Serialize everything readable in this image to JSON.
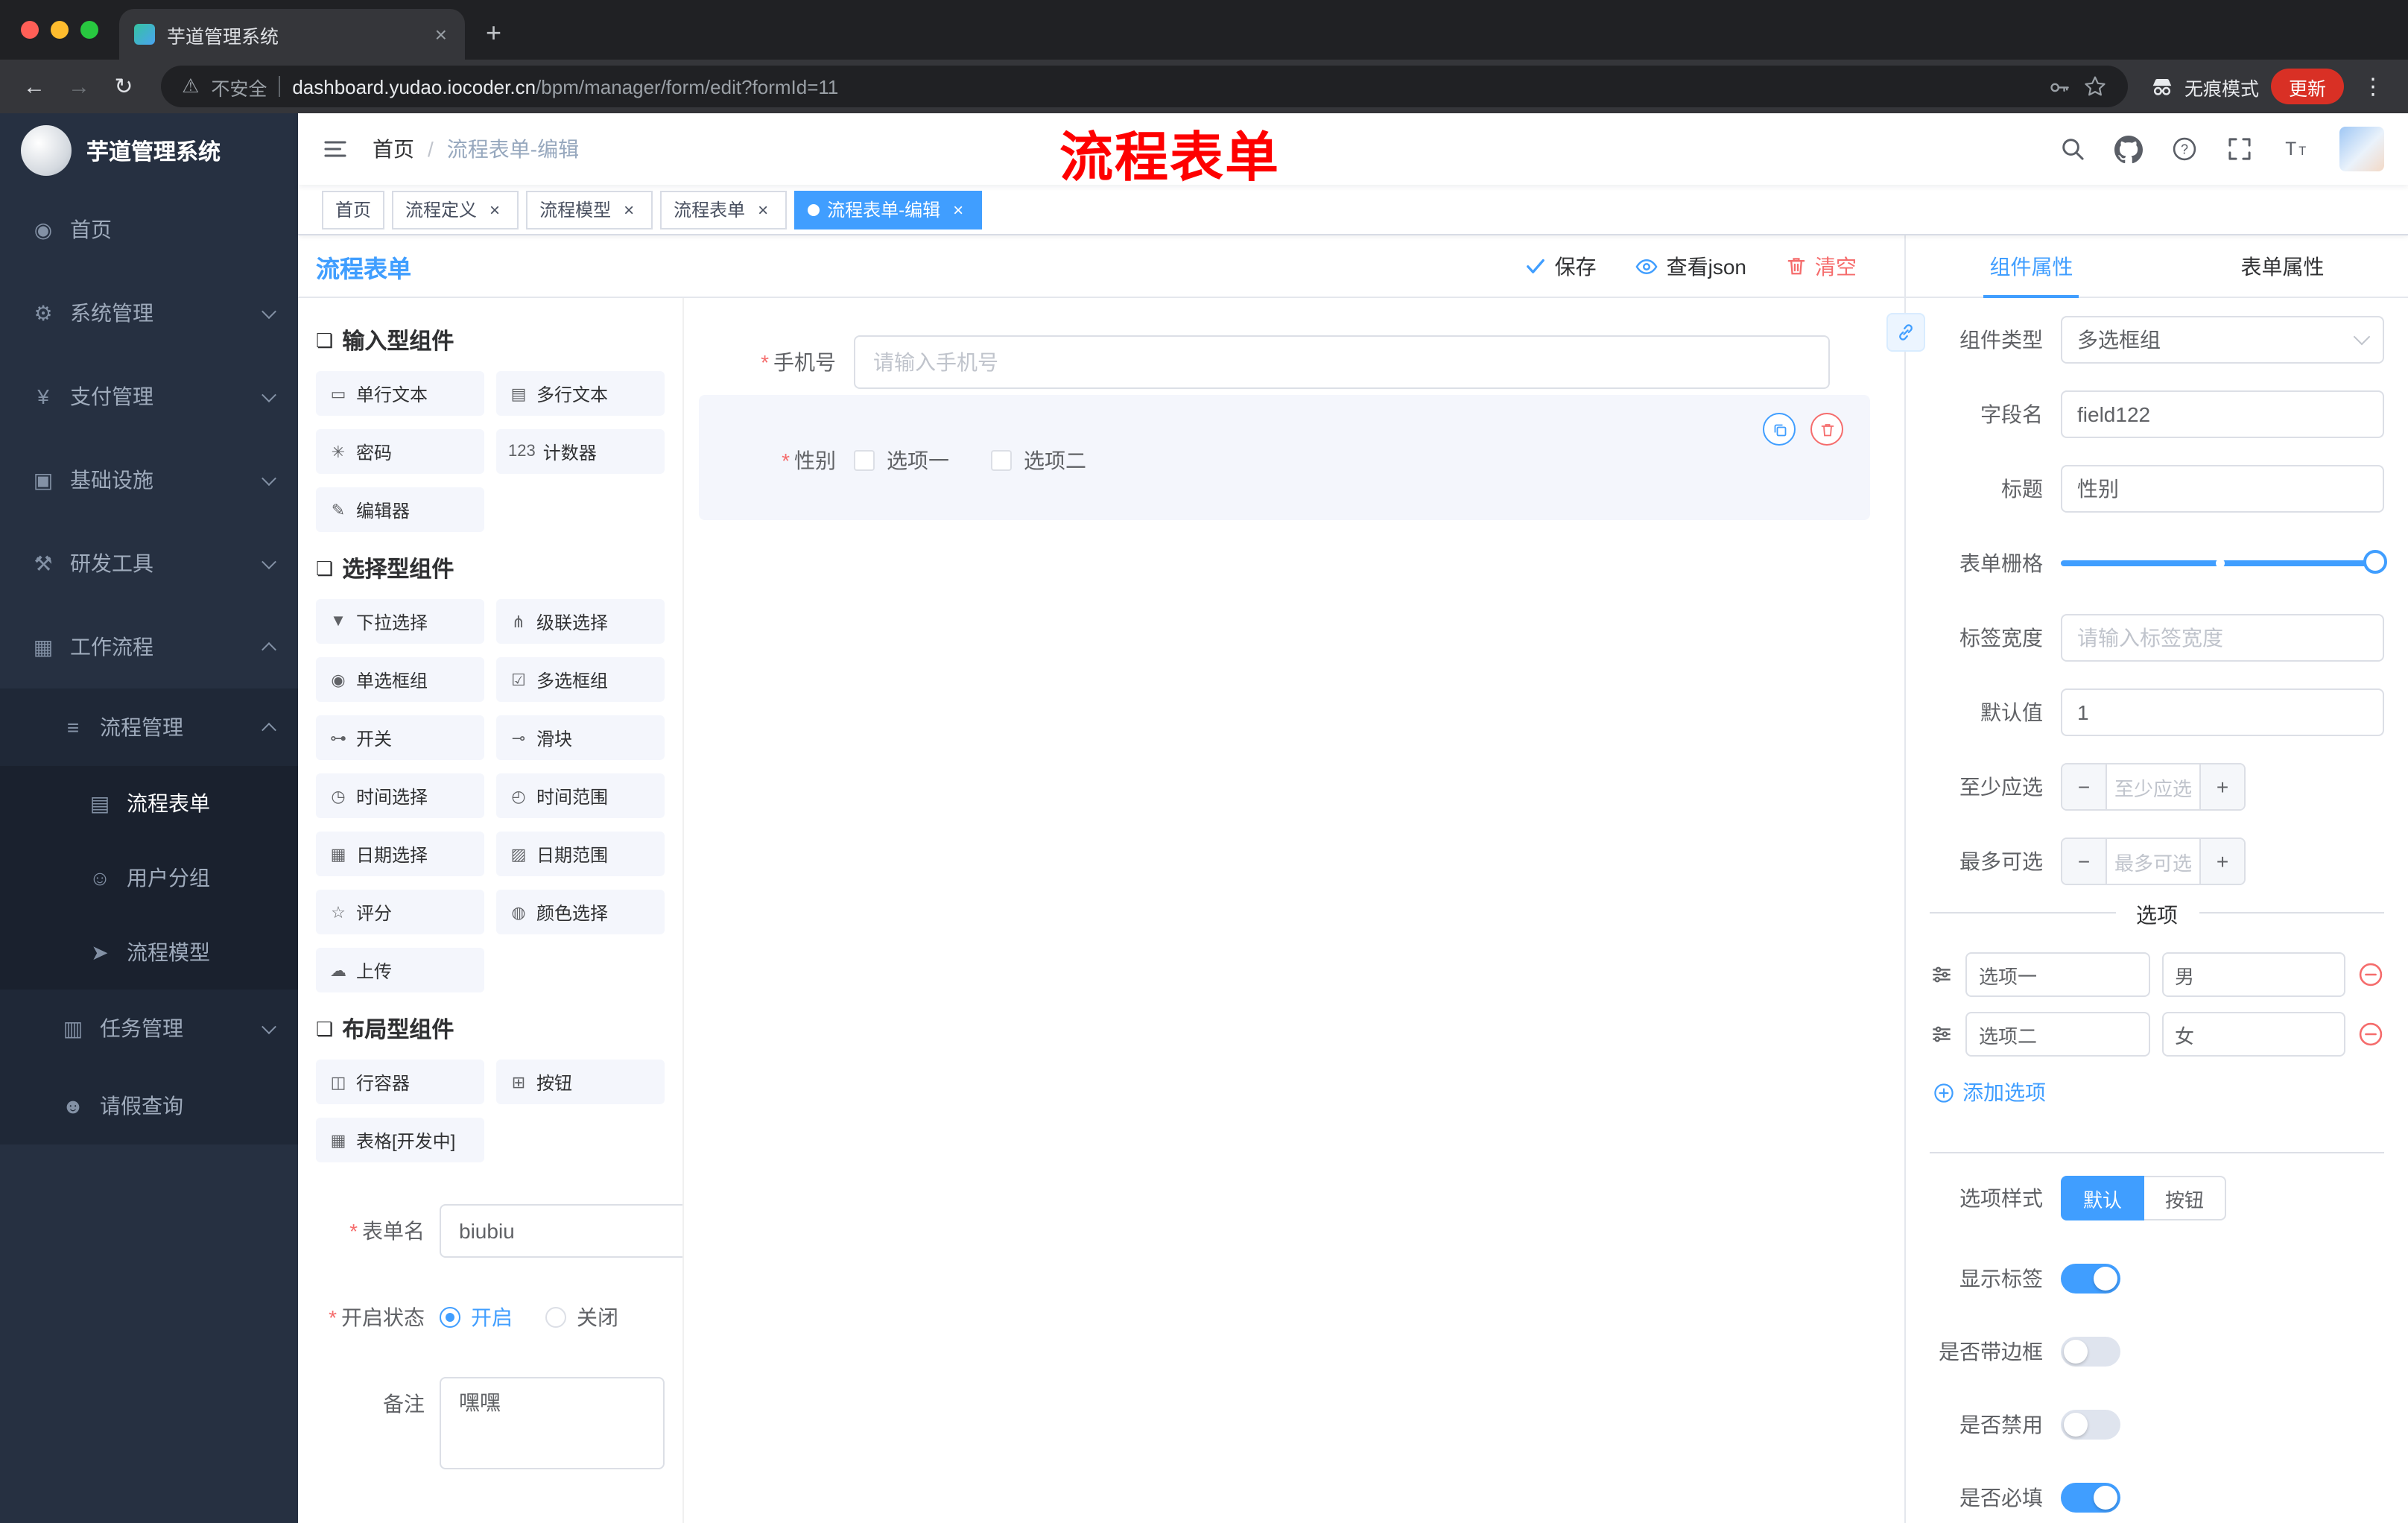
{
  "icons": {
    "back": "←",
    "forward": "→",
    "reload": "↻",
    "warning": "⚠",
    "dots": "⋮",
    "close": "×",
    "new_tab": "+",
    "slash": "/",
    "star_req": "*",
    "minus": "−",
    "plus": "+"
  },
  "browser": {
    "tab_title": "芋道管理系统",
    "security": "不安全",
    "url_host": "dashboard.yudao.iocoder.cn",
    "url_path": "/bpm/manager/form/edit?formId=11",
    "incognito": "无痕模式",
    "update": "更新"
  },
  "header": {
    "logo_title": "芋道管理系统",
    "breadcrumb_root": "首页",
    "breadcrumb_current": "流程表单-编辑",
    "annotation": "流程表单"
  },
  "sidebar": {
    "items": [
      {
        "label": "首页",
        "icon": "◉"
      },
      {
        "label": "系统管理",
        "icon": "⚙"
      },
      {
        "label": "支付管理",
        "icon": "¥"
      },
      {
        "label": "基础设施",
        "icon": "▣"
      },
      {
        "label": "研发工具",
        "icon": "⚒"
      },
      {
        "label": "工作流程",
        "icon": "▦"
      },
      {
        "label": "流程管理",
        "icon": "≡"
      },
      {
        "label": "流程表单",
        "icon": "▤"
      },
      {
        "label": "用户分组",
        "icon": "☺"
      },
      {
        "label": "流程模型",
        "icon": "➤"
      },
      {
        "label": "任务管理",
        "icon": "▥"
      },
      {
        "label": "请假查询",
        "icon": "☻"
      }
    ]
  },
  "tags": {
    "items": [
      {
        "label": "首页"
      },
      {
        "label": "流程定义"
      },
      {
        "label": "流程模型"
      },
      {
        "label": "流程表单"
      },
      {
        "label": "流程表单-编辑"
      }
    ]
  },
  "designer": {
    "title": "流程表单",
    "actions": {
      "save": "保存",
      "view_json": "查看json",
      "clear": "清空"
    },
    "palette": {
      "sections": [
        {
          "title": "输入型组件",
          "icon": "❏",
          "items": [
            {
              "label": "单行文本",
              "icon": "▭"
            },
            {
              "label": "多行文本",
              "icon": "▤"
            },
            {
              "label": "密码",
              "icon": "✳"
            },
            {
              "label": "计数器",
              "icon": "123"
            },
            {
              "label": "编辑器",
              "icon": "✎"
            }
          ]
        },
        {
          "title": "选择型组件",
          "icon": "❏",
          "items": [
            {
              "label": "下拉选择",
              "icon": "▼"
            },
            {
              "label": "级联选择",
              "icon": "⋔"
            },
            {
              "label": "单选框组",
              "icon": "◉"
            },
            {
              "label": "多选框组",
              "icon": "☑"
            },
            {
              "label": "开关",
              "icon": "⊶"
            },
            {
              "label": "滑块",
              "icon": "⊸"
            },
            {
              "label": "时间选择",
              "icon": "◷"
            },
            {
              "label": "时间范围",
              "icon": "◴"
            },
            {
              "label": "日期选择",
              "icon": "▦"
            },
            {
              "label": "日期范围",
              "icon": "▨"
            },
            {
              "label": "评分",
              "icon": "☆"
            },
            {
              "label": "颜色选择",
              "icon": "◍"
            },
            {
              "label": "上传",
              "icon": "☁"
            }
          ]
        },
        {
          "title": "布局型组件",
          "icon": "❏",
          "items": [
            {
              "label": "行容器",
              "icon": "◫"
            },
            {
              "label": "按钮",
              "icon": "⊞"
            },
            {
              "label": "表格[开发中]",
              "icon": "▦"
            }
          ]
        }
      ]
    },
    "form_meta": {
      "name_label": "表单名",
      "name_value": "biubiu",
      "status_label": "开启状态",
      "status_on": "开启",
      "status_off": "关闭",
      "remark_label": "备注",
      "remark_value": "嘿嘿"
    },
    "canvas": {
      "phone_label": "手机号",
      "phone_placeholder": "请输入手机号",
      "gender_label": "性别",
      "gender_option1": "选项一",
      "gender_option2": "选项二"
    },
    "props": {
      "tab_component": "组件属性",
      "tab_form": "表单属性",
      "component_type_label": "组件类型",
      "component_type_value": "多选框组",
      "field_name_label": "字段名",
      "field_name_value": "field122",
      "title_label": "标题",
      "title_value": "性别",
      "grid_label": "表单栅格",
      "label_width_label": "标签宽度",
      "label_width_placeholder": "请输入标签宽度",
      "default_label": "默认值",
      "default_value": "1",
      "min_label": "至少应选",
      "min_placeholder": "至少应选",
      "max_label": "最多可选",
      "max_placeholder": "最多可选",
      "options_title": "选项",
      "options": [
        {
          "label": "选项一",
          "value": "男"
        },
        {
          "label": "选项二",
          "value": "女"
        }
      ],
      "add_option": "添加选项",
      "style_label": "选项样式",
      "style_default": "默认",
      "style_button": "按钮",
      "toggles": [
        {
          "label": "显示标签",
          "on": true
        },
        {
          "label": "是否带边框",
          "on": false
        },
        {
          "label": "是否禁用",
          "on": false
        },
        {
          "label": "是否必填",
          "on": true
        }
      ]
    }
  },
  "colors": {
    "accent": "#409eff",
    "danger": "#f56c6c",
    "annotation_red": "#fe0000"
  }
}
